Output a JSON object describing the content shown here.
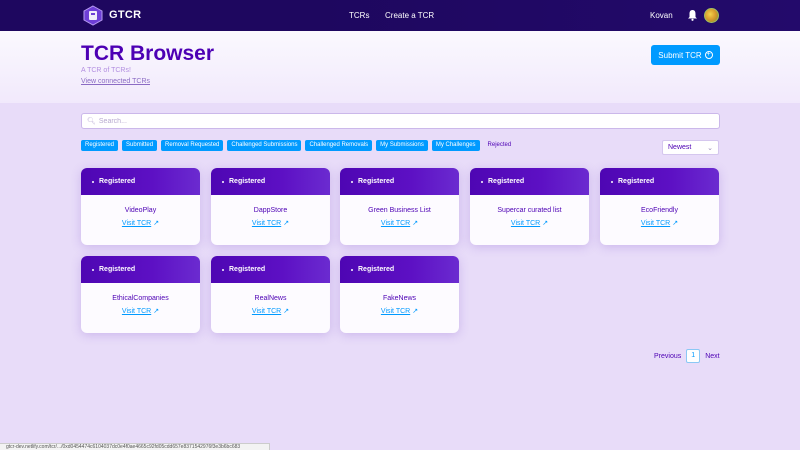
{
  "nav": {
    "logo_text": "GTCR",
    "links": [
      "TCRs",
      "Create a TCR"
    ],
    "network": "Kovan"
  },
  "header": {
    "title": "TCR Browser",
    "subtitle": "A TCR of TCRs!",
    "connected_link": "View connected TCRs",
    "submit_label": "Submit TCR"
  },
  "search": {
    "placeholder": "Search..."
  },
  "filters": [
    {
      "label": "Registered",
      "active": true
    },
    {
      "label": "Submitted",
      "active": true
    },
    {
      "label": "Removal Requested",
      "active": true
    },
    {
      "label": "Challenged Submissions",
      "active": true
    },
    {
      "label": "Challenged Removals",
      "active": true
    },
    {
      "label": "My Submissions",
      "active": true
    },
    {
      "label": "My Challenges",
      "active": true
    },
    {
      "label": "Rejected",
      "active": false
    }
  ],
  "sort": {
    "selected": "Newest"
  },
  "cards": [
    {
      "status": "Registered",
      "name": "VideoPlay",
      "link": "Visit TCR"
    },
    {
      "status": "Registered",
      "name": "DappStore",
      "link": "Visit TCR"
    },
    {
      "status": "Registered",
      "name": "Green Business List",
      "link": "Visit TCR"
    },
    {
      "status": "Registered",
      "name": "Supercar curated list",
      "link": "Visit TCR"
    },
    {
      "status": "Registered",
      "name": "EcoFriendly",
      "link": "Visit TCR"
    },
    {
      "status": "Registered",
      "name": "EthicalCompanies",
      "link": "Visit TCR"
    },
    {
      "status": "Registered",
      "name": "RealNews",
      "link": "Visit TCR"
    },
    {
      "status": "Registered",
      "name": "FakeNews",
      "link": "Visit TCR"
    }
  ],
  "pagination": {
    "prev": "Previous",
    "current": "1",
    "next": "Next"
  },
  "statusbar": {
    "url": "gtcr-dev.netlify.com/tcr/.../0xd0454474c6104037dc0e4f0ae4665c92fd05cdd657e8371542976f3e3b6bc683"
  },
  "colors": {
    "accent": "#009aff",
    "primary": "#4d00b4",
    "nav_bg": "#1e075f",
    "page_bg": "#e8dcf9"
  },
  "icons": {
    "logo": "gtcr-logo-icon",
    "bell": "bell-icon",
    "plus": "plus-circle-icon",
    "search": "search-icon",
    "external": "external-link-icon",
    "chevron": "chevron-down-icon"
  }
}
